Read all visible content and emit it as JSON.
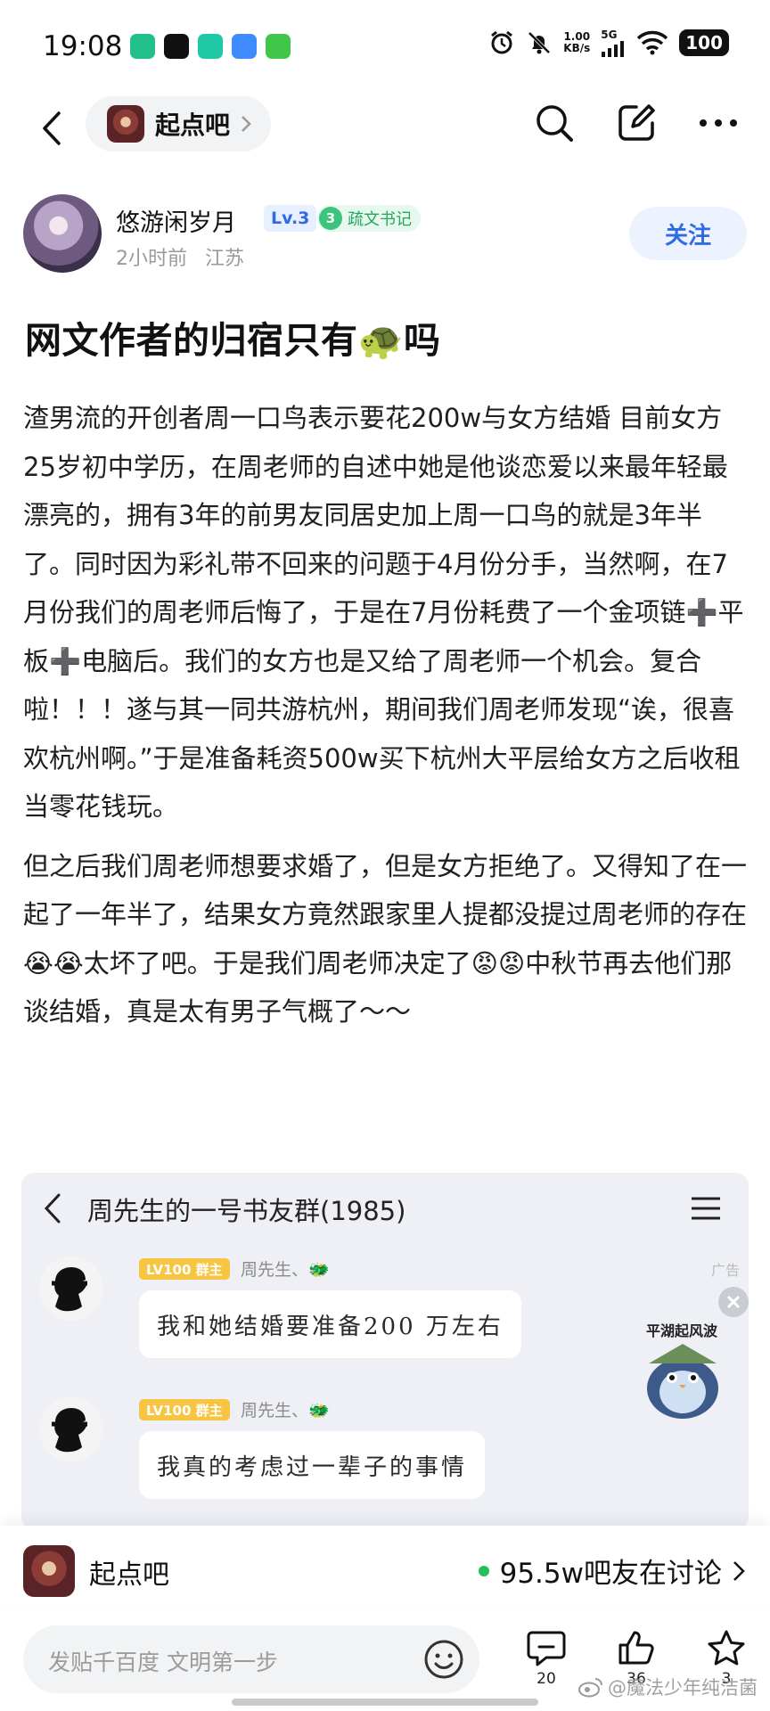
{
  "status_bar": {
    "time": "19:08",
    "net_speed_value": "1.00",
    "net_speed_unit": "KB/s",
    "network": "5G",
    "battery": "100",
    "app_icon_colors": [
      "#22c189",
      "#111111",
      "#1ec8a5",
      "#3d8bff",
      "#41c64b"
    ]
  },
  "nav": {
    "forum_name": "起点吧"
  },
  "author": {
    "name": "悠游闲岁月",
    "level": "Lv.3",
    "title_level": "3",
    "title": "疏文书记",
    "time": "2小时前",
    "location": "江苏",
    "follow_label": "关注"
  },
  "post": {
    "title": "网文作者的归宿只有🐢吗",
    "paragraphs": [
      "渣男流的开创者周一口鸟表示要花200w与女方结婚 目前女方25岁初中学历，在周老师的自述中她是他谈恋爱以来最年轻最漂亮的，拥有3年的前男友同居史加上周一口鸟的就是3年半了。同时因为彩礼带不回来的问题于4月份分手，当然啊，在7月份我们的周老师后悔了，于是在7月份耗费了一个金项链➕平板➕电脑后。我们的女方也是又给了周老师一个机会。复合啦！！！遂与其一同共游杭州，期间我们周老师发现“诶，很喜欢杭州啊。”于是准备耗资500w买下杭州大平层给女方之后收租当零花钱玩。",
      "但之后我们周老师想要求婚了，但是女方拒绝了。又得知了在一起了一年半了，结果女方竟然跟家里人提都没提过周老师的存在😭😭太坏了吧。于是我们周老师决定了😡😡中秋节再去他们那谈结婚，真是太有男子气概了～～"
    ]
  },
  "screenshot": {
    "group_title": "周先生的一号书友群(1985)",
    "ad_label": "广告",
    "sticker_caption": "平湖起风波",
    "messages": [
      {
        "badge": "LV100 群主",
        "sender": "周先生、🐲",
        "text": "我和她结婚要准备200 万左右"
      },
      {
        "badge": "LV100 群主",
        "sender": "周先生、🐲",
        "text": "我真的考虑过一辈子的事情"
      }
    ]
  },
  "forum_bar": {
    "name": "起点吧",
    "discussing": "95.5w吧友在讨论"
  },
  "input_bar": {
    "placeholder": "发贴千百度 文明第一步",
    "comment_count": "20",
    "like_count": "36",
    "favorite_count": "3"
  },
  "watermark": "@魔法少年纯洁菌"
}
